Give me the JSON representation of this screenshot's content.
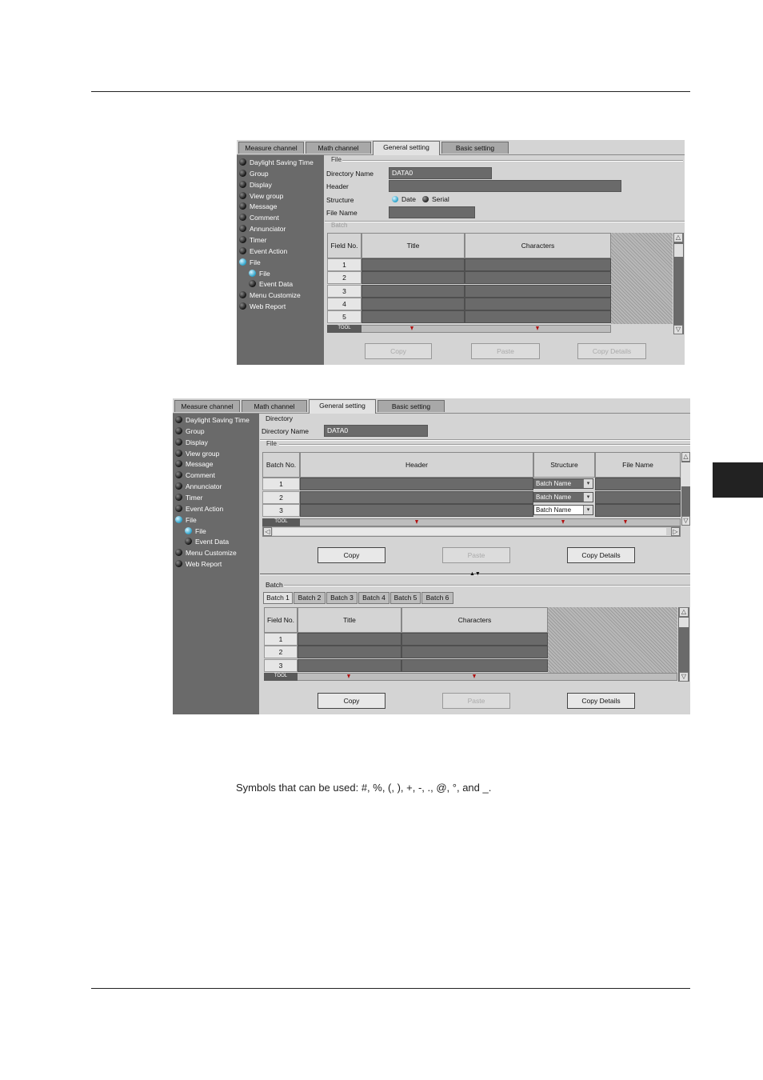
{
  "shot1": {
    "tabs": [
      "Measure channel",
      "Math channel",
      "General setting",
      "Basic setting"
    ],
    "nav": [
      {
        "label": "Daylight Saving Time",
        "active": false
      },
      {
        "label": "Group",
        "active": false
      },
      {
        "label": "Display",
        "active": false
      },
      {
        "label": "View group",
        "active": false
      },
      {
        "label": "Message",
        "active": false
      },
      {
        "label": "Comment",
        "active": false
      },
      {
        "label": "Annunciator",
        "active": false
      },
      {
        "label": "Timer",
        "active": false
      },
      {
        "label": "Event Action",
        "active": false
      },
      {
        "label": "File",
        "active": true
      },
      {
        "label": "File",
        "active": true,
        "sub": true
      },
      {
        "label": "Event Data",
        "active": false,
        "sub": true
      },
      {
        "label": "Menu Customize",
        "active": false
      },
      {
        "label": "Web Report",
        "active": false
      }
    ],
    "file_group": "File",
    "directory_label": "Directory Name",
    "directory_value": "DATA0",
    "header_label": "Header",
    "structure_label": "Structure",
    "structure_date": "Date",
    "structure_serial": "Serial",
    "filename_label": "File Name",
    "batch_group": "Batch",
    "col_field": "Field No.",
    "col_title": "Title",
    "col_chars": "Characters",
    "rows": [
      "1",
      "2",
      "3",
      "4",
      "5"
    ],
    "tool": "TOOL",
    "buttons": {
      "copy": "Copy",
      "paste": "Paste",
      "details": "Copy Details"
    }
  },
  "shot2": {
    "tabs": [
      "Measure channel",
      "Math channel",
      "General setting",
      "Basic setting"
    ],
    "nav": [
      {
        "label": "Daylight Saving Time",
        "active": false
      },
      {
        "label": "Group",
        "active": false
      },
      {
        "label": "Display",
        "active": false
      },
      {
        "label": "View group",
        "active": false
      },
      {
        "label": "Message",
        "active": false
      },
      {
        "label": "Comment",
        "active": false
      },
      {
        "label": "Annunciator",
        "active": false
      },
      {
        "label": "Timer",
        "active": false
      },
      {
        "label": "Event Action",
        "active": false
      },
      {
        "label": "File",
        "active": true
      },
      {
        "label": "File",
        "active": true,
        "sub": true
      },
      {
        "label": "Event Data",
        "active": false,
        "sub": true
      },
      {
        "label": "Menu Customize",
        "active": false
      },
      {
        "label": "Web Report",
        "active": false
      }
    ],
    "directory_group": "Directory",
    "directory_label": "Directory Name",
    "directory_value": "DATA0",
    "file_group": "File",
    "col_batch": "Batch No.",
    "col_header": "Header",
    "col_structure": "Structure",
    "col_filename": "File Name",
    "file_rows": [
      {
        "no": "1",
        "structure": "Batch Name"
      },
      {
        "no": "2",
        "structure": "Batch Name"
      },
      {
        "no": "3",
        "structure": "Batch Name"
      }
    ],
    "tool": "TOOL",
    "batch_group": "Batch",
    "batch_tabs": [
      "Batch 1",
      "Batch 2",
      "Batch 3",
      "Batch 4",
      "Batch 5",
      "Batch 6"
    ],
    "col_field": "Field No.",
    "col_title": "Title",
    "col_chars": "Characters",
    "batch_rows": [
      "1",
      "2",
      "3"
    ],
    "buttons": {
      "copy": "Copy",
      "paste": "Paste",
      "details": "Copy Details"
    }
  },
  "caption": "Symbols that can be used:   #, %, (, ), +, -, ., @, °, and _."
}
